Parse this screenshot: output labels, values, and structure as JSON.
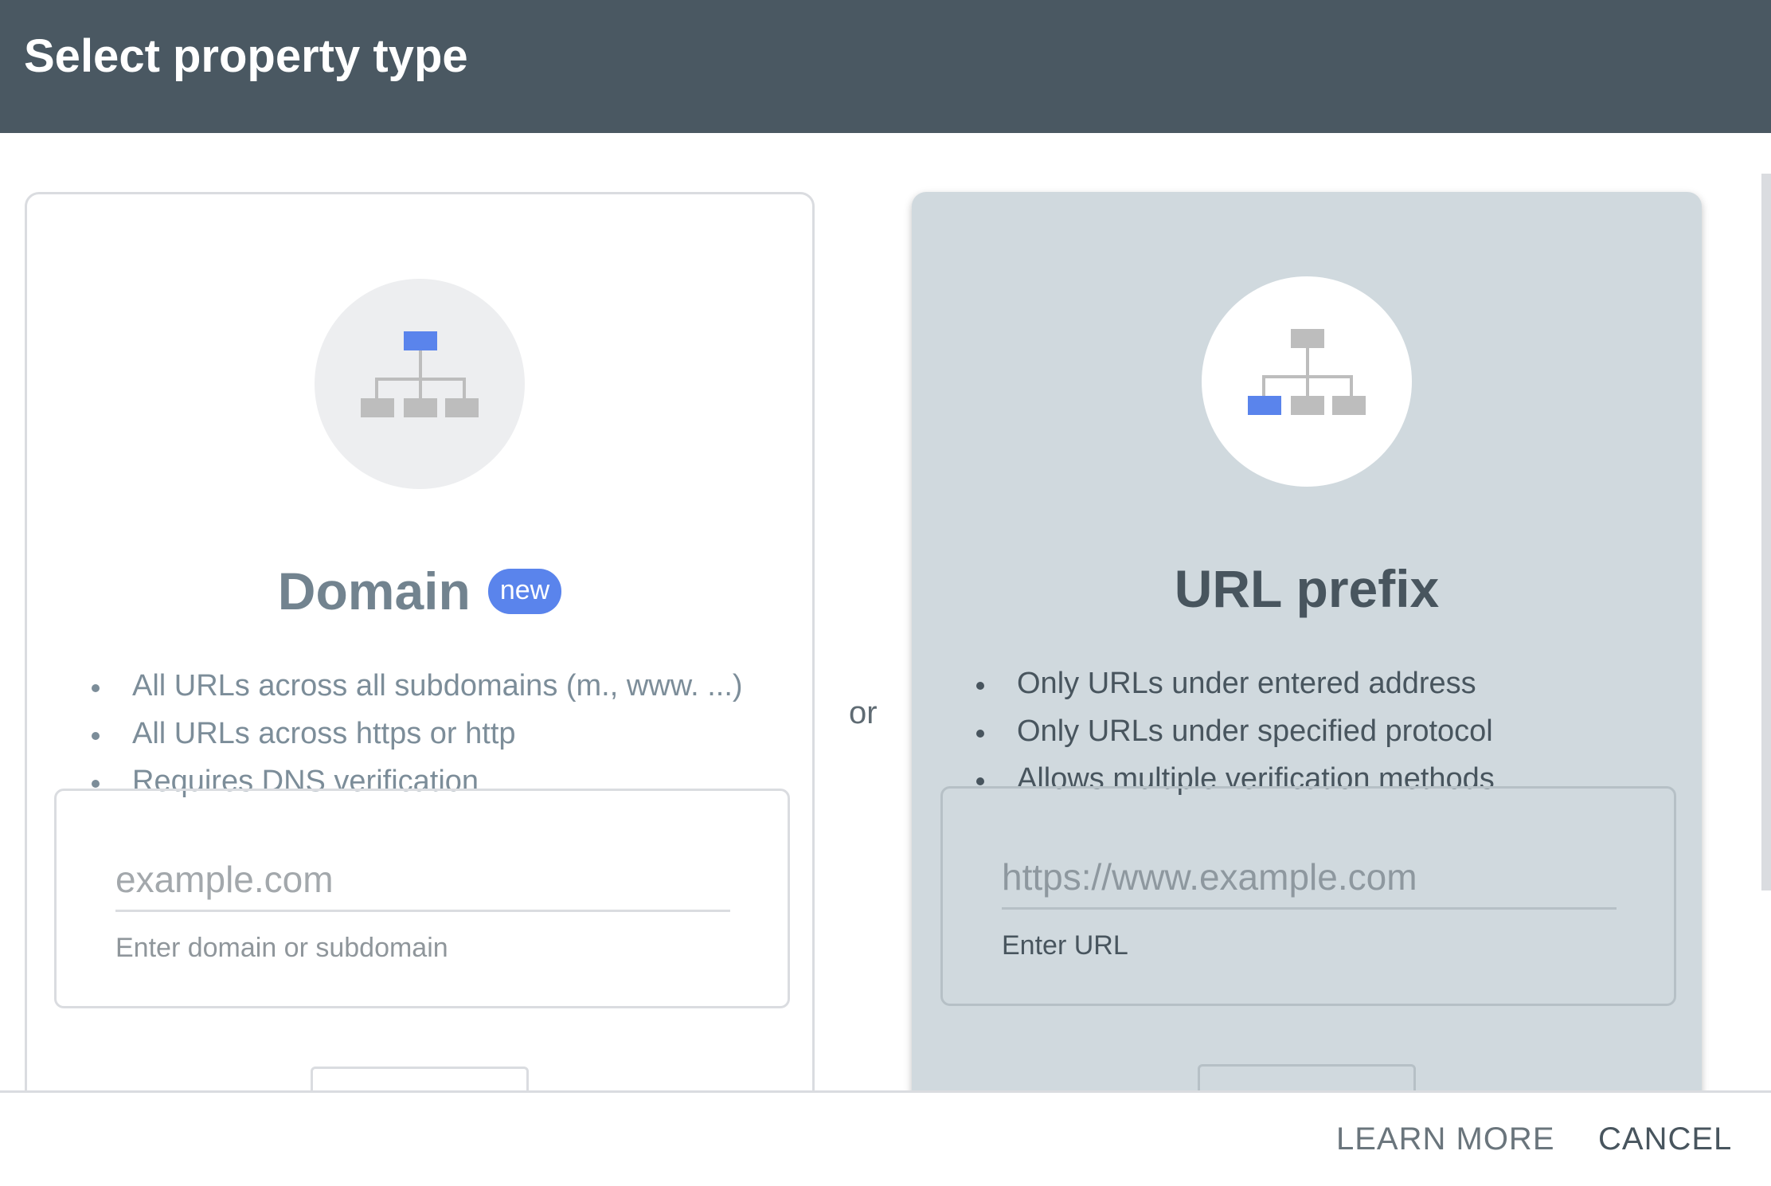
{
  "header": {
    "title": "Select property type"
  },
  "domain_card": {
    "title": "Domain",
    "badge": "new",
    "features": [
      "All URLs across all subdomains (m., www. ...)",
      "All URLs across https or http",
      "Requires DNS verification"
    ],
    "input_placeholder": "example.com",
    "input_hint": "Enter domain or subdomain",
    "icon": "sitemap-icon",
    "highlight_color": "#5a84ec"
  },
  "separator": {
    "text": "or"
  },
  "url_card": {
    "title": "URL prefix",
    "features": [
      "Only URLs under entered address",
      "Only URLs under specified protocol",
      "Allows multiple verification methods"
    ],
    "input_placeholder": "https://www.example.com",
    "input_hint": "Enter URL",
    "icon": "sitemap-icon",
    "highlight_color": "#5a84ec"
  },
  "footer": {
    "learn_more_label": "LEARN MORE",
    "cancel_label": "CANCEL"
  },
  "colors": {
    "header_bg": "#4a5862",
    "accent": "#5a84ec",
    "selected_card_bg": "#d0d9de"
  }
}
